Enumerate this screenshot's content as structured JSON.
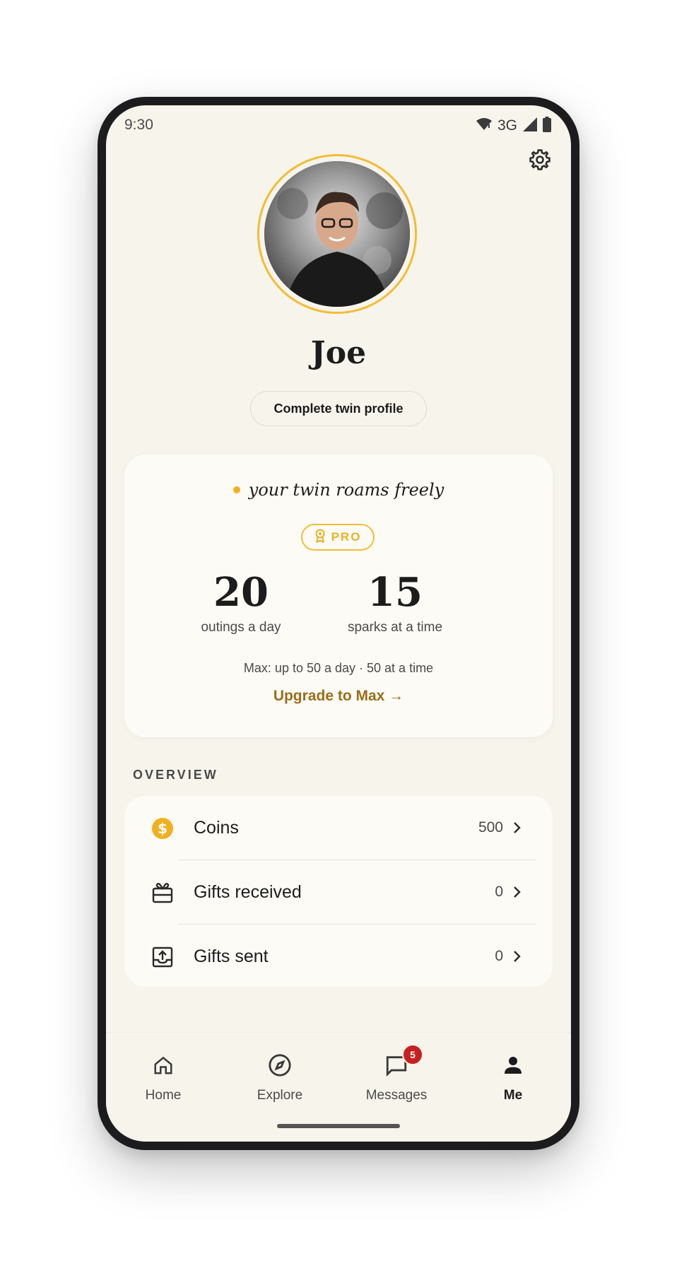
{
  "status_bar": {
    "time": "9:30",
    "network": "3G"
  },
  "profile": {
    "name": "Joe",
    "complete_button": "Complete twin profile"
  },
  "plan": {
    "tagline": "your twin roams freely",
    "badge": "PRO",
    "stats": [
      {
        "value": "20",
        "label": "outings a day"
      },
      {
        "value": "15",
        "label": "sparks at a time"
      }
    ],
    "max_note": "Max: up to 50 a day · 50 at a time",
    "upgrade_label": "Upgrade to Max →"
  },
  "overview": {
    "title": "OVERVIEW",
    "items": [
      {
        "label": "Coins",
        "value": "500",
        "icon": "coin-icon"
      },
      {
        "label": "Gifts received",
        "value": "0",
        "icon": "gift-icon"
      },
      {
        "label": "Gifts sent",
        "value": "0",
        "icon": "upload-icon"
      }
    ]
  },
  "nav": {
    "items": [
      {
        "label": "Home",
        "icon": "home-icon"
      },
      {
        "label": "Explore",
        "icon": "compass-icon"
      },
      {
        "label": "Messages",
        "icon": "chat-icon",
        "badge": "5"
      },
      {
        "label": "Me",
        "icon": "person-icon",
        "active": true
      }
    ]
  },
  "colors": {
    "accent_gold": "#f2bd34",
    "link_brown": "#9a6e1a",
    "background": "#f7f4ec",
    "badge_red": "#c62020"
  }
}
